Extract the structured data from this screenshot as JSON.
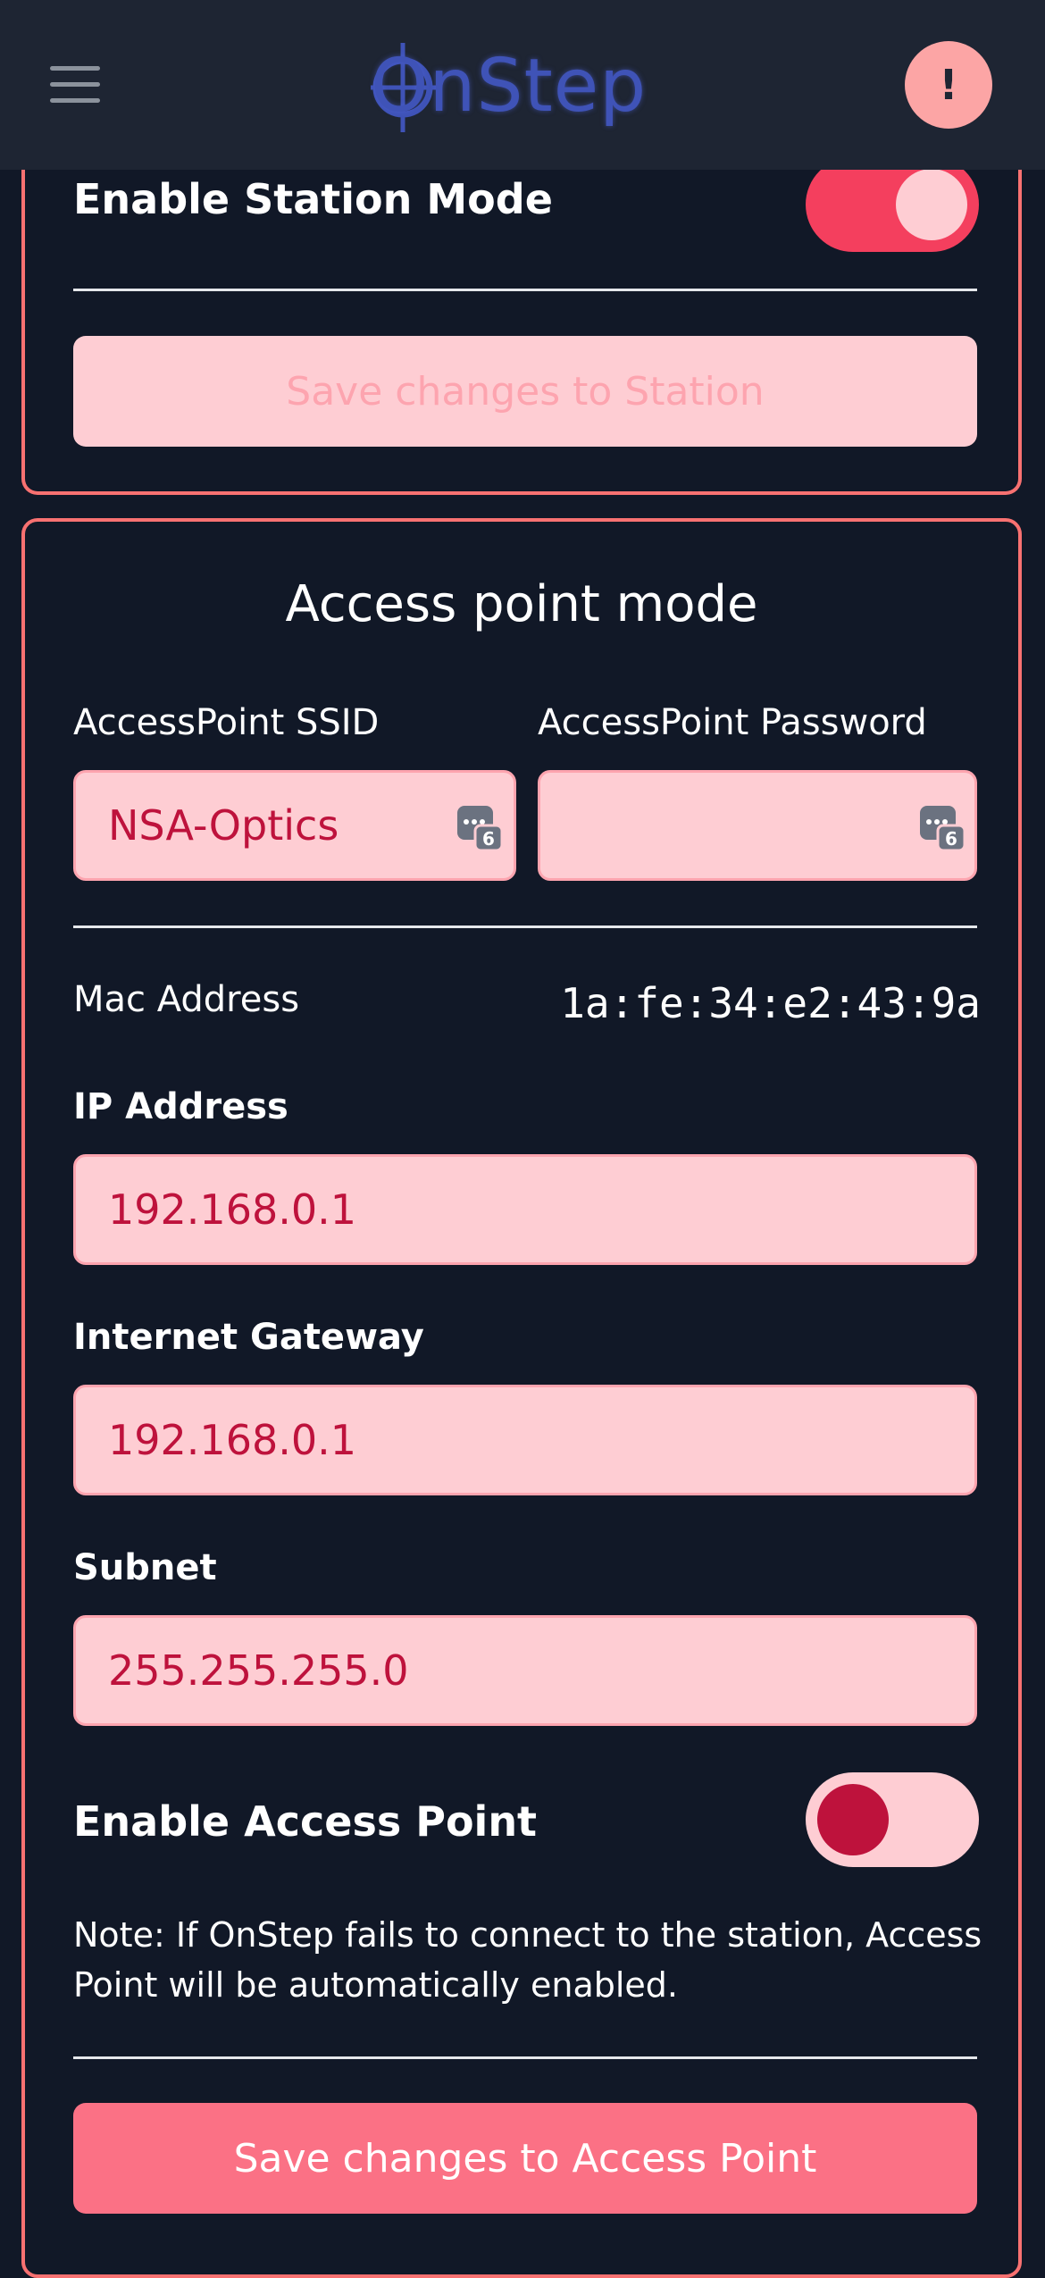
{
  "header": {
    "logo_text": "OnStep",
    "alert_icon_label": "!"
  },
  "station": {
    "enable_label": "Enable Station Mode",
    "enabled": true,
    "save_label": "Save changes to Station"
  },
  "access_point": {
    "title": "Access point mode",
    "ssid_label": "AccessPoint SSID",
    "ssid_value": "NSA-Optics",
    "password_label": "AccessPoint Password",
    "password_value": "",
    "mac_label": "Mac Address",
    "mac_value": "1a:fe:34:e2:43:9a",
    "ip_label": "IP Address",
    "ip_value": "192.168.0.1",
    "gateway_label": "Internet Gateway",
    "gateway_value": "192.168.0.1",
    "subnet_label": "Subnet",
    "subnet_value": "255.255.255.0",
    "enable_label": "Enable Access Point",
    "enabled": false,
    "note": "Note: If OnStep fails to connect to the station, Access Point will be automatically enabled.",
    "save_label": "Save changes to Access Point"
  },
  "icons": {
    "menu": "hamburger-menu-icon",
    "alert": "exclamation-icon",
    "password_manager": "password-key-icon"
  },
  "colors": {
    "background": "#111827",
    "header": "#1e2533",
    "accent": "#f87171",
    "input_bg": "#fecdd3",
    "input_text": "#be123c",
    "logo": "#3f53b7"
  }
}
